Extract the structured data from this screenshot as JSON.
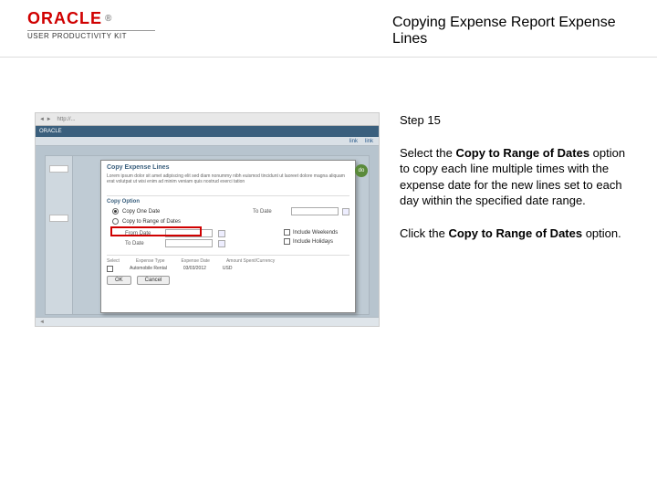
{
  "logo": {
    "brand": "ORACLE",
    "registered": "®",
    "subline": "USER PRODUCTIVITY KIT"
  },
  "title": "Copying Expense Report Expense Lines",
  "step": "Step 15",
  "instruction": {
    "p1_a": "Select the ",
    "p1_b": "Copy to Range of Dates",
    "p1_c": " option to copy each line multiple times with the expense date for the new lines set to each day within the specified date range.",
    "p2_a": "Click the ",
    "p2_b": "Copy to Range of Dates",
    "p2_c": " option."
  },
  "shot": {
    "brand": "ORACLE",
    "dialog_title": "Copy Expense Lines",
    "section": "Copy Option",
    "opt1": "Copy One Date",
    "opt2": "Copy to Range of Dates",
    "to_date": "To Date",
    "from_date": "From Date",
    "chk1": "Include Weekends",
    "chk2": "Include Holidays",
    "col1": "Select",
    "col2": "Expense Type",
    "col3": "Expense Date",
    "col4": "Amount Spent/Currency",
    "row_type": "Automobile Rental",
    "row_date": "03/03/2012",
    "row_amt": "USD",
    "ok": "OK",
    "cancel": "Cancel",
    "go": "do",
    "foot": "◄"
  }
}
